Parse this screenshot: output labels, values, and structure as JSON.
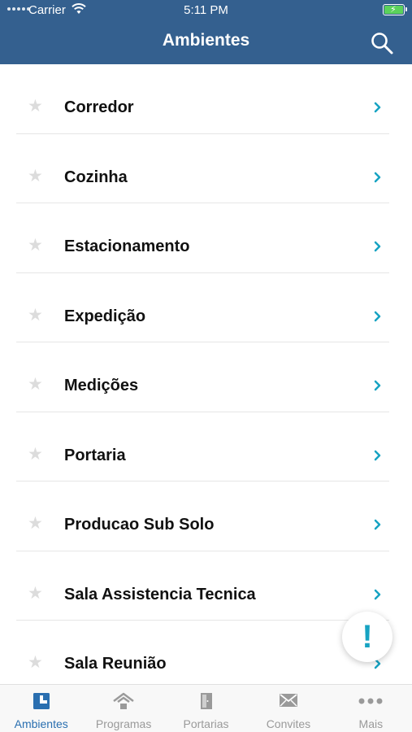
{
  "status_bar": {
    "carrier": "Carrier",
    "time": "5:11 PM"
  },
  "header": {
    "title": "Ambientes"
  },
  "environments": [
    {
      "name": "Corredor"
    },
    {
      "name": "Cozinha"
    },
    {
      "name": "Estacionamento"
    },
    {
      "name": "Expedição"
    },
    {
      "name": "Medições"
    },
    {
      "name": "Portaria"
    },
    {
      "name": "Producao Sub Solo"
    },
    {
      "name": "Sala Assistencia Tecnica"
    },
    {
      "name": "Sala Reunião"
    }
  ],
  "fab": {
    "symbol": "!"
  },
  "tabs": [
    {
      "label": "Ambientes",
      "icon": "ambientes-icon"
    },
    {
      "label": "Programas",
      "icon": "home-icon"
    },
    {
      "label": "Portarias",
      "icon": "door-icon"
    },
    {
      "label": "Convites",
      "icon": "envelope-icon"
    },
    {
      "label": "Mais",
      "icon": "more-icon"
    }
  ],
  "colors": {
    "header": "#34608f",
    "accent": "#17a3c2",
    "tab_active": "#2a6fb0",
    "tab_inactive": "#9a9a9a"
  }
}
